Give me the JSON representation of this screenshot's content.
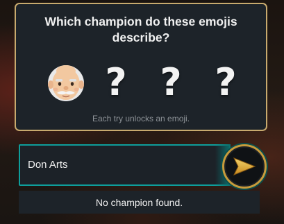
{
  "quiz": {
    "title": "Which champion do these emojis describe?",
    "emojis": [
      {
        "icon": "old-man-emoji",
        "revealed": true
      },
      {
        "label": "?",
        "revealed": false
      },
      {
        "label": "?",
        "revealed": false
      },
      {
        "label": "?",
        "revealed": false
      }
    ],
    "hint": "Each try unlocks an emoji."
  },
  "guess": {
    "value": "Don Arts",
    "submit_icon": "arrow-right-icon"
  },
  "result": {
    "message": "No champion found."
  },
  "colors": {
    "gold_border": "#c8aa6e",
    "teal_border": "#0e9e9b",
    "panel_bg": "#1d2329"
  }
}
